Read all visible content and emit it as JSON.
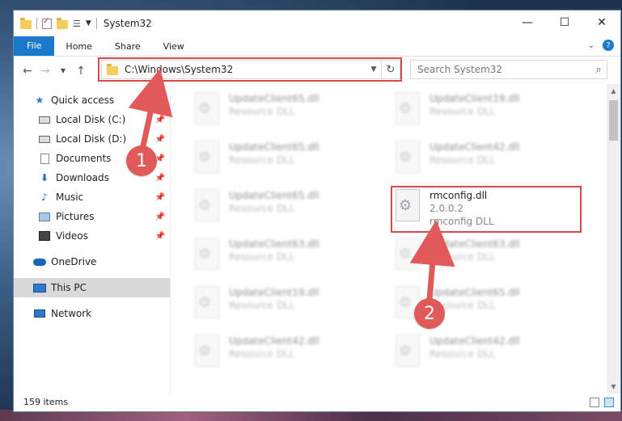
{
  "window": {
    "title": "System32",
    "controls": {
      "minimize": "—",
      "maximize": "☐",
      "close": "✕"
    }
  },
  "ribbon": {
    "tabs": [
      "File",
      "Home",
      "Share",
      "View"
    ]
  },
  "address": {
    "path": "C:\\Windows\\System32",
    "search_placeholder": "Search System32"
  },
  "sidebar": {
    "items": [
      {
        "label": "Quick access",
        "icon": "star-icon"
      },
      {
        "label": "Local Disk (C:)",
        "icon": "drive-icon",
        "pinned": true
      },
      {
        "label": "Local Disk (D:)",
        "icon": "drive-icon",
        "pinned": true
      },
      {
        "label": "Documents",
        "icon": "document-icon",
        "pinned": true
      },
      {
        "label": "Downloads",
        "icon": "download-icon",
        "pinned": true
      },
      {
        "label": "Music",
        "icon": "music-icon",
        "pinned": true
      },
      {
        "label": "Pictures",
        "icon": "pictures-icon",
        "pinned": true
      },
      {
        "label": "Videos",
        "icon": "videos-icon",
        "pinned": true
      },
      {
        "label": "OneDrive",
        "icon": "cloud-icon"
      },
      {
        "label": "This PC",
        "icon": "computer-icon",
        "selected": true
      },
      {
        "label": "Network",
        "icon": "network-icon"
      }
    ]
  },
  "files": [
    {
      "name": "UpdateClient65.dll",
      "sub": "Resource DLL"
    },
    {
      "name": "UpdateClient19.dll",
      "sub": "Resource DLL"
    },
    {
      "name": "UpdateClient65.dll",
      "sub": "Resource DLL"
    },
    {
      "name": "UpdateClient42.dll",
      "sub": "Resource DLL"
    },
    {
      "name": "UpdateClient65.dll",
      "sub": "Resource DLL"
    },
    {
      "name": "rmconfig.dll",
      "version": "2.0.0.2",
      "sub": "rmconfig DLL",
      "highlighted": true
    },
    {
      "name": "UpdateClient63.dll",
      "sub": "Resource DLL"
    },
    {
      "name": "UpdateClient63.dll",
      "sub": "Resource DLL"
    },
    {
      "name": "UpdateClient19.dll",
      "sub": "Resource DLL"
    },
    {
      "name": "UpdateClient65.dll",
      "sub": "Resource DLL"
    },
    {
      "name": "UpdateClient42.dll",
      "sub": "Resource DLL"
    },
    {
      "name": "UpdateClient42.dll",
      "sub": "Resource DLL"
    }
  ],
  "status": {
    "count": "159 items"
  },
  "callouts": [
    "1",
    "2"
  ],
  "colors": {
    "accent": "#1979ca",
    "annotation": "#e15959"
  }
}
